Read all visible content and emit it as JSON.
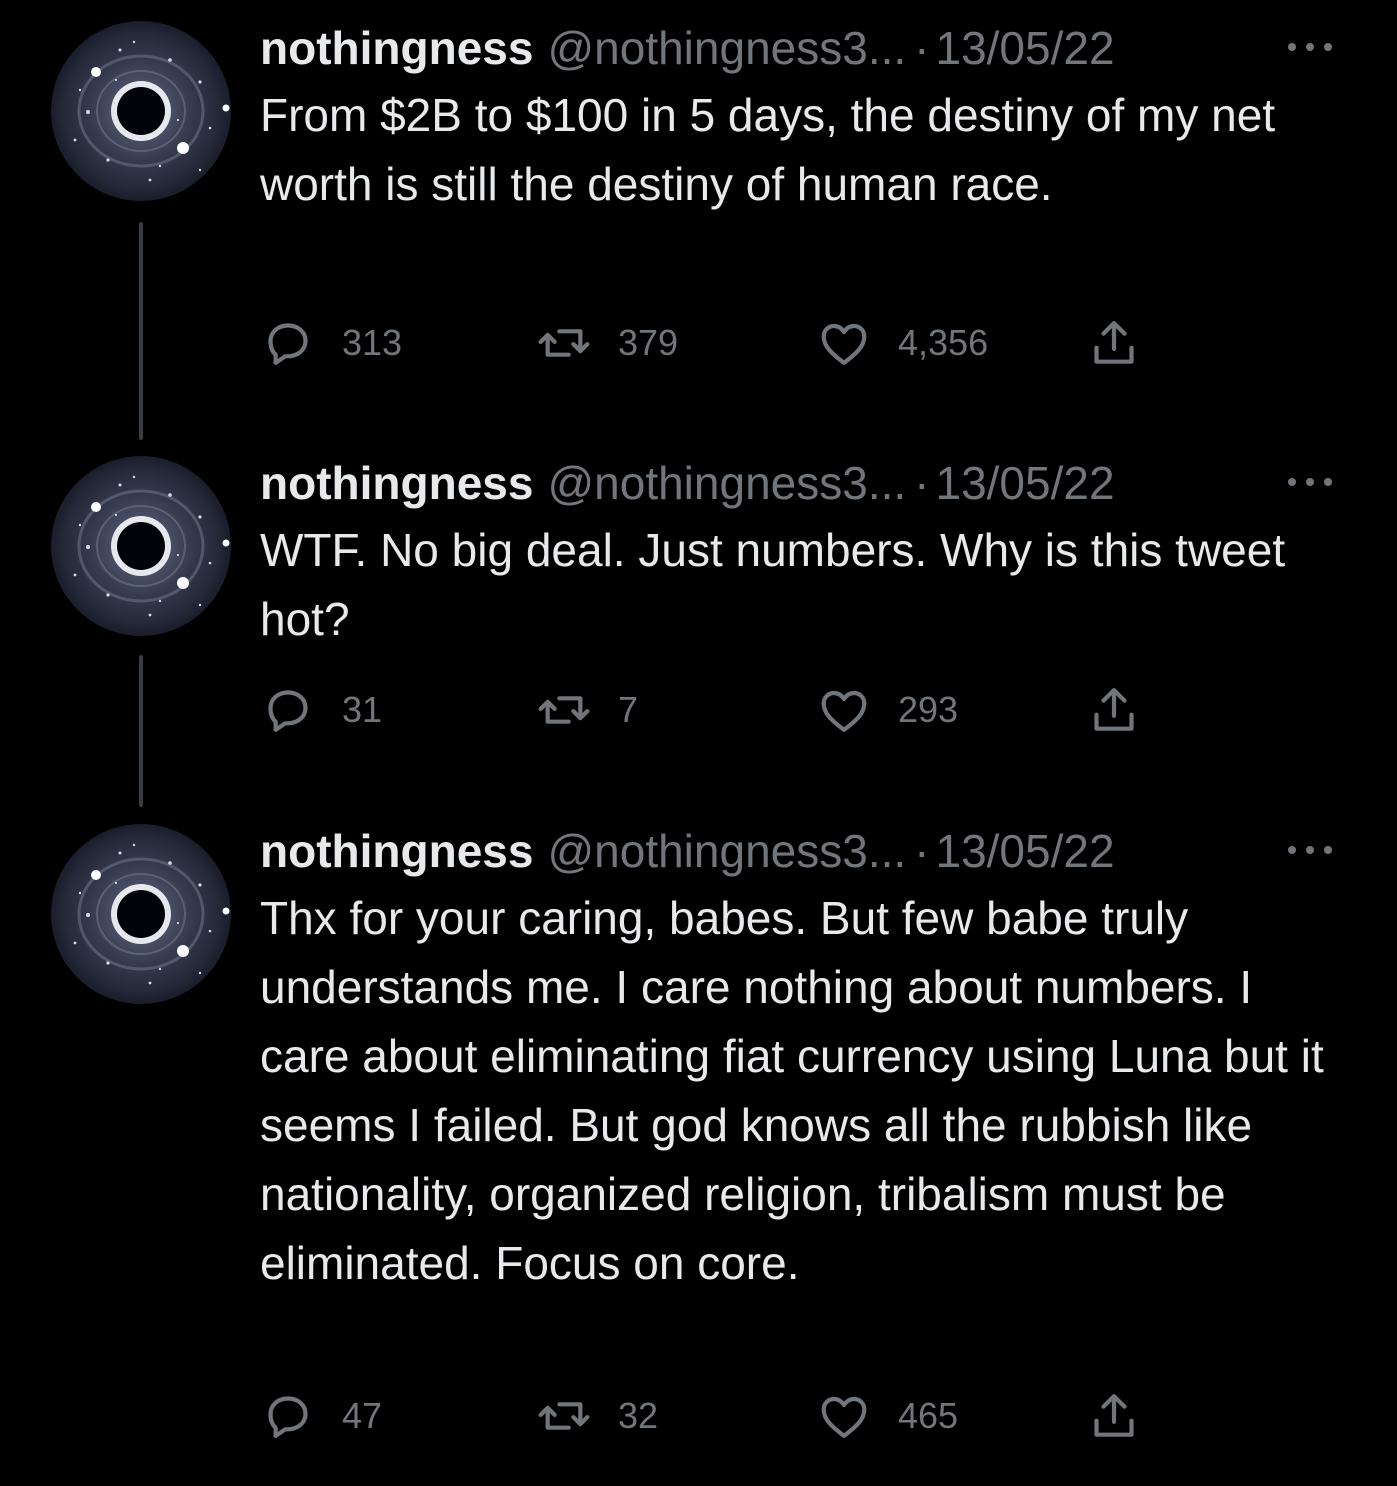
{
  "colors": {
    "background": "#000000",
    "text_primary": "#e7e9ea",
    "text_secondary": "#71767b",
    "thread_line": "#3a3d40"
  },
  "tweets": [
    {
      "display_name": "nothingness",
      "handle": "@nothingness3...",
      "separator": "·",
      "date": "13/05/22",
      "text": "From $2B to $100 in 5 days, the destiny of my net worth is still the destiny of human race.",
      "replies": "313",
      "retweets": "379",
      "likes": "4,356",
      "avatar_icon": "galaxy-avatar-icon"
    },
    {
      "display_name": "nothingness",
      "handle": "@nothingness3...",
      "separator": "·",
      "date": "13/05/22",
      "text": "WTF. No big deal. Just numbers. Why is this tweet hot?",
      "replies": "31",
      "retweets": "7",
      "likes": "293",
      "avatar_icon": "galaxy-avatar-icon"
    },
    {
      "display_name": "nothingness",
      "handle": "@nothingness3...",
      "separator": "·",
      "date": "13/05/22",
      "text": "Thx for your caring, babes. But few babe truly understands me. I care nothing about numbers. I care about eliminating fiat currency using Luna but it seems I failed. But god knows all the rubbish like nationality, organized religion, tribalism must be eliminated. Focus on core.",
      "replies": "47",
      "retweets": "32",
      "likes": "465",
      "avatar_icon": "galaxy-avatar-icon"
    }
  ],
  "icons": {
    "reply": "reply-bubble-icon",
    "retweet": "retweet-arrows-icon",
    "like": "heart-icon",
    "share": "share-upload-icon",
    "more": "more-dots-icon"
  }
}
